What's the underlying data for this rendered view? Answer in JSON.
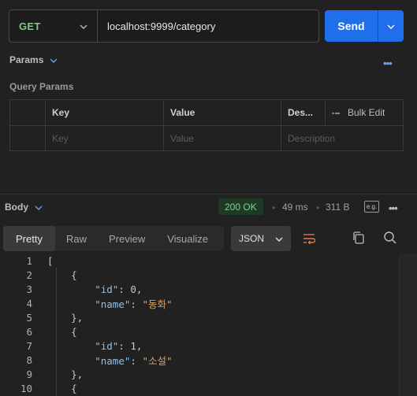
{
  "request": {
    "method": "GET",
    "url": "localhost:9999/category",
    "send_label": "Send"
  },
  "params": {
    "section_label": "Params",
    "query_label": "Query Params",
    "headers": {
      "key": "Key",
      "value": "Value",
      "desc": "Des...",
      "bulk": "Bulk Edit"
    },
    "placeholders": {
      "key": "Key",
      "value": "Value",
      "desc": "Description"
    }
  },
  "response": {
    "body_label": "Body",
    "status": "200 OK",
    "time": "49 ms",
    "size": "311 B",
    "tabs": [
      "Pretty",
      "Raw",
      "Preview",
      "Visualize"
    ],
    "active_tab": "Pretty",
    "format": "JSON"
  },
  "code_lines": [
    {
      "n": "1",
      "t": "["
    },
    {
      "n": "2",
      "t": "    {"
    },
    {
      "n": "3",
      "k": "\"id\"",
      "v": "0",
      "type": "num"
    },
    {
      "n": "4",
      "k": "\"name\"",
      "v": "\"동화\"",
      "type": "str"
    },
    {
      "n": "5",
      "t": "    },"
    },
    {
      "n": "6",
      "t": "    {"
    },
    {
      "n": "7",
      "k": "\"id\"",
      "v": "1",
      "type": "num"
    },
    {
      "n": "8",
      "k": "\"name\"",
      "v": "\"소설\"",
      "type": "str"
    },
    {
      "n": "9",
      "t": "    },"
    },
    {
      "n": "10",
      "t": "    {"
    }
  ],
  "colors": {
    "accent": "#1f6fea",
    "status_bg": "#1e3a24",
    "status_fg": "#7fd08a",
    "method": "#7fc97f"
  }
}
